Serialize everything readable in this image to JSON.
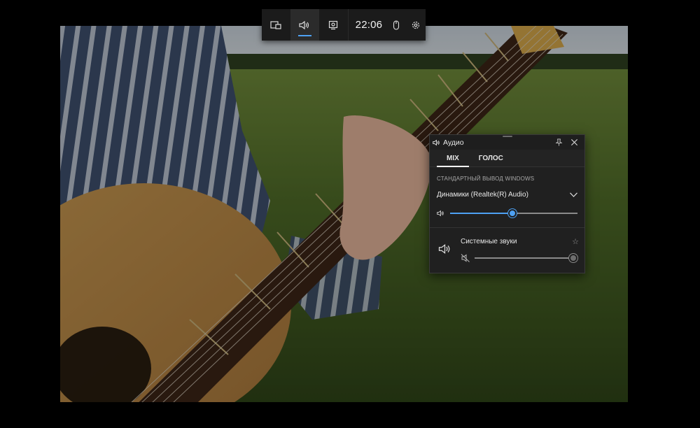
{
  "gamebar": {
    "clock": "22:06",
    "buttons": [
      {
        "icon": "widget-menu-icon"
      },
      {
        "icon": "audio-icon",
        "active": true
      },
      {
        "icon": "capture-icon"
      },
      {
        "icon": "mouse-icon"
      },
      {
        "icon": "gear-icon"
      }
    ]
  },
  "audio_panel": {
    "title": "Аудио",
    "tabs": [
      {
        "label": "MIX",
        "active": true
      },
      {
        "label": "ГОЛОС",
        "active": false
      }
    ],
    "section_title": "СТАНДАРТНЫЙ ВЫВОД WINDOWS",
    "device_name": "Динамики (Realtek(R) Audio)",
    "master_volume_percent": 49,
    "apps": [
      {
        "name": "Системные звуки",
        "volume_percent": 100,
        "muted": true
      }
    ]
  },
  "colors": {
    "accent": "#4ea1f3",
    "panel_bg": "#202020",
    "gamebar_bg": "#1b1b1b"
  }
}
